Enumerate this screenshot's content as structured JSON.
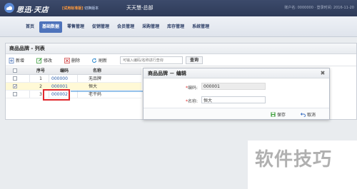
{
  "app": {
    "logo": "思迅",
    "logo_sub": "天店",
    "edition_tag": "[试用标准版]",
    "edition_link": "切换版本",
    "store": "天天慧-总部",
    "account": "账户名: 0000000    ·    登录时间: 2016-11-20"
  },
  "nav": {
    "items": [
      {
        "label": "首页",
        "active": false
      },
      {
        "label": "基础数据",
        "active": true
      },
      {
        "label": "零售管理",
        "active": false
      },
      {
        "label": "促销管理",
        "active": false
      },
      {
        "label": "会员管理",
        "active": false
      },
      {
        "label": "采购管理",
        "active": false
      },
      {
        "label": "库存管理",
        "active": false
      },
      {
        "label": "系统管理",
        "active": false
      }
    ]
  },
  "panel": {
    "title": "商品品牌 - 列表",
    "toolbar": {
      "add": "新增",
      "edit": "修改",
      "delete": "删除",
      "refresh": "刷新",
      "search_placeholder": "可输入编码/名称进行查询",
      "search_button": "查询"
    },
    "grid": {
      "headers": {
        "no": "序号",
        "code": "编码",
        "name": "名称"
      },
      "rows": [
        {
          "no": "1",
          "code": "000000",
          "name": "无品牌",
          "checked": false
        },
        {
          "no": "2",
          "code": "000001",
          "name": "恒大",
          "checked": true
        },
        {
          "no": "3",
          "code": "000002",
          "name": "老干妈",
          "checked": false
        }
      ]
    }
  },
  "dialog": {
    "title": "商品品牌 － 编辑",
    "code_label": "编码:",
    "code_value": "000001",
    "name_label": "名称:",
    "name_value": "恒大",
    "required_mark": "*",
    "save": "保存",
    "cancel": "取消"
  },
  "watermark": "软件技巧",
  "colors": {
    "nav_active": "#4e73bb",
    "highlight": "#e0282e",
    "arrow": "#5aa0e0",
    "save_icon": "#3a9d3a"
  }
}
